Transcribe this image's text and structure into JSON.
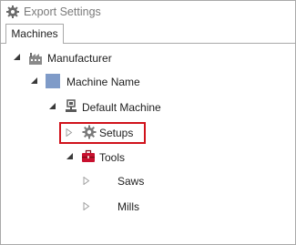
{
  "window": {
    "title": "Export Settings",
    "title_icon": "gear-icon"
  },
  "tabs": [
    {
      "label": "Machines",
      "selected": true
    }
  ],
  "tree": {
    "manufacturer": {
      "label": "Manufacturer",
      "icon": "factory-icon",
      "expanded": true
    },
    "machine_name": {
      "label": "Machine Name",
      "icon": "blue-square-icon",
      "expanded": true
    },
    "default_machine": {
      "label": "Default Machine",
      "icon": "machine-icon",
      "expanded": true
    },
    "setups": {
      "label": "Setups",
      "icon": "gear-icon",
      "expanded": false,
      "highlighted": true
    },
    "tools": {
      "label": "Tools",
      "icon": "toolbox-icon",
      "expanded": true
    },
    "saws": {
      "label": "Saws",
      "expanded": false
    },
    "mills": {
      "label": "Mills",
      "expanded": false
    }
  },
  "colors": {
    "highlight_border": "#d0121b",
    "border": "#a9a9a9",
    "title_text": "#7a7a7a",
    "machine_name_icon": "#7f9bc8",
    "toolbox": "#c8102e"
  }
}
